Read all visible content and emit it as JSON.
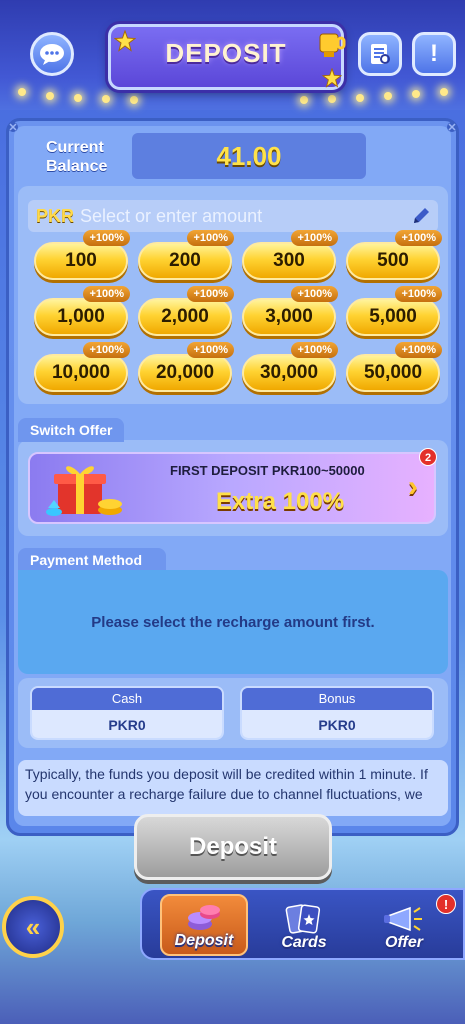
{
  "header": {
    "title": "DEPOSIT",
    "left_button_icon": "chat-icon",
    "right_buttons": [
      {
        "icon": "history-icon"
      },
      {
        "icon": "info-icon",
        "glyph": "!"
      }
    ]
  },
  "balance": {
    "label_line1": "Current",
    "label_line2": "Balance",
    "value": "41.00"
  },
  "amount": {
    "currency": "PKR",
    "placeholder": "Select or enter amount",
    "options": [
      {
        "value": "100",
        "bonus": "+100%"
      },
      {
        "value": "200",
        "bonus": "+100%"
      },
      {
        "value": "300",
        "bonus": "+100%"
      },
      {
        "value": "500",
        "bonus": "+100%"
      },
      {
        "value": "1,000",
        "bonus": "+100%"
      },
      {
        "value": "2,000",
        "bonus": "+100%"
      },
      {
        "value": "3,000",
        "bonus": "+100%"
      },
      {
        "value": "5,000",
        "bonus": "+100%"
      },
      {
        "value": "10,000",
        "bonus": "+100%"
      },
      {
        "value": "20,000",
        "bonus": "+100%"
      },
      {
        "value": "30,000",
        "bonus": "+100%"
      },
      {
        "value": "50,000",
        "bonus": "+100%"
      }
    ]
  },
  "switch_offer": {
    "label": "Switch Offer",
    "headline": "FIRST DEPOSIT  PKR100~50000",
    "reward": "Extra 100%",
    "badge": "2"
  },
  "payment_method": {
    "label": "Payment Method",
    "message": "Please select the recharge amount first."
  },
  "wallets": {
    "cash": {
      "label": "Cash",
      "value": "PKR0"
    },
    "bonus": {
      "label": "Bonus",
      "value": "PKR0"
    }
  },
  "note": "Typically, the funds you deposit will be credited within 1 minute. If you encounter a recharge failure due to channel fluctuations, we",
  "deposit_button": "Deposit",
  "nav": {
    "back_glyph": "«",
    "items": [
      {
        "label": "Deposit",
        "icon": "coins-icon"
      },
      {
        "label": "Cards",
        "icon": "cards-icon"
      },
      {
        "label": "Offer",
        "icon": "megaphone-icon"
      }
    ],
    "offer_badge": "!"
  },
  "colors": {
    "gold": "#ffd332",
    "panel": "#82a9f6",
    "accent_blue": "#4f6cd6"
  }
}
